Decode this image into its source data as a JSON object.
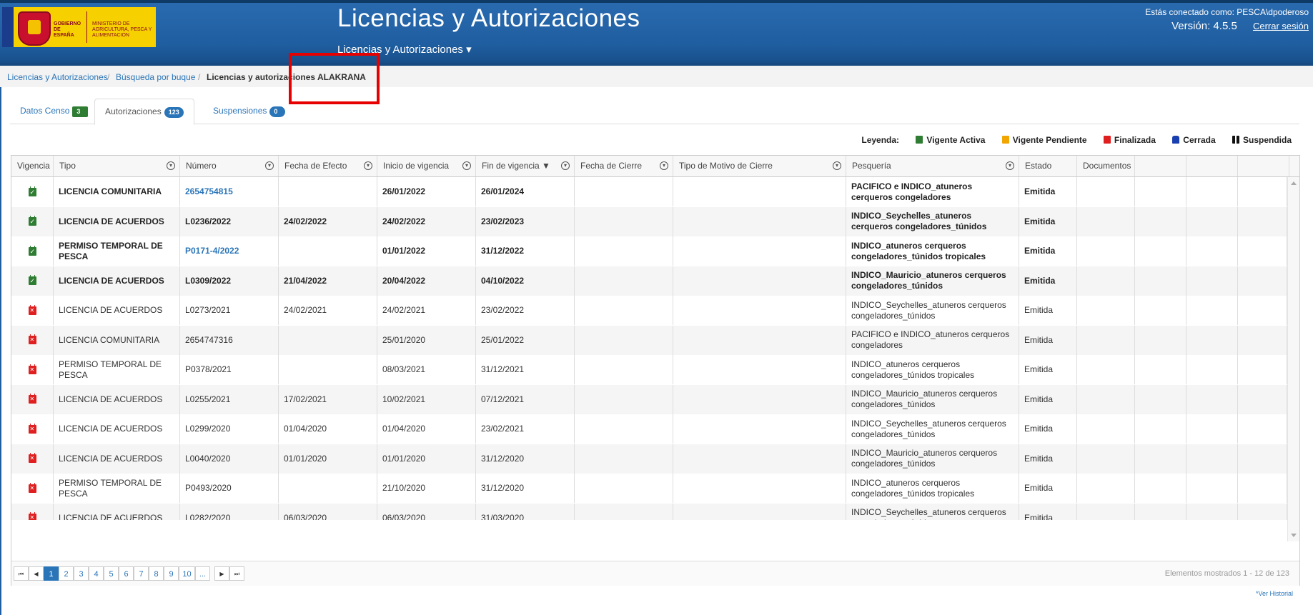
{
  "header": {
    "gov_line1": "GOBIERNO DE ESPAÑA",
    "gov_line2": "MINISTERIO DE AGRICULTURA, PESCA Y ALIMENTACIÓN",
    "title": "Licencias y Autorizaciones",
    "menu_label": "Licencias y Autorizaciones ▾",
    "user_text": "Estás conectado como: PESCA\\dpoderoso",
    "version_text": "Versión: 4.5.5",
    "logout_label": "Cerrar sesión"
  },
  "breadcrumb": {
    "item1": "Licencias y Autorizaciones",
    "item2": "Búsqueda por buque",
    "current": "Licencias y autorizaciones ALAKRANA",
    "sep": "/"
  },
  "tabs": [
    {
      "label": "Datos Censo",
      "count": "3"
    },
    {
      "label": "Autorizaciones",
      "count": "123"
    },
    {
      "label": "Suspensiones",
      "count": "0"
    }
  ],
  "legend": {
    "label": "Leyenda:",
    "items": [
      "Vigente Activa",
      "Vigente Pendiente",
      "Finalizada",
      "Cerrada",
      "Suspendida"
    ],
    "colors": [
      "#2e7d32",
      "#f0a500",
      "#e02020",
      "#1a3fb0",
      "#111111"
    ]
  },
  "columns": [
    "Vigencia",
    "Tipo",
    "Número",
    "Fecha de Efecto",
    "Inicio de vigencia",
    "Fin de vigencia ▼",
    "Fecha de Cierre",
    "Tipo de Motivo de Cierre",
    "Pesquería",
    "Estado",
    "Documentos"
  ],
  "rows": [
    {
      "vigencia": "activa",
      "tipo": "LICENCIA COMUNITARIA",
      "numero": "2654754815",
      "efecto": "",
      "inicio": "26/01/2022",
      "fin": "26/01/2024",
      "cierre": "",
      "motivo": "",
      "pesqueria": "PACIFICO e INDICO_atuneros cerqueros congeladores",
      "estado": "Emitida"
    },
    {
      "vigencia": "activa",
      "tipo": "LICENCIA DE ACUERDOS",
      "numero": "L0236/2022",
      "efecto": "24/02/2022",
      "inicio": "24/02/2022",
      "fin": "23/02/2023",
      "cierre": "",
      "motivo": "",
      "pesqueria": "INDICO_Seychelles_atuneros cerqueros congeladores_túnidos",
      "estado": "Emitida"
    },
    {
      "vigencia": "activa",
      "tipo": "PERMISO TEMPORAL DE PESCA",
      "numero": "P0171-4/2022",
      "efecto": "",
      "inicio": "01/01/2022",
      "fin": "31/12/2022",
      "cierre": "",
      "motivo": "",
      "pesqueria": "INDICO_atuneros cerqueros congeladores_túnidos tropicales",
      "estado": "Emitida"
    },
    {
      "vigencia": "activa",
      "tipo": "LICENCIA DE ACUERDOS",
      "numero": "L0309/2022",
      "efecto": "21/04/2022",
      "inicio": "20/04/2022",
      "fin": "04/10/2022",
      "cierre": "",
      "motivo": "",
      "pesqueria": "INDICO_Mauricio_atuneros cerqueros congeladores_túnidos",
      "estado": "Emitida"
    },
    {
      "vigencia": "finalizada",
      "tipo": "LICENCIA DE ACUERDOS",
      "numero": "L0273/2021",
      "efecto": "24/02/2021",
      "inicio": "24/02/2021",
      "fin": "23/02/2022",
      "cierre": "",
      "motivo": "",
      "pesqueria": "INDICO_Seychelles_atuneros cerqueros congeladores_túnidos",
      "estado": "Emitida"
    },
    {
      "vigencia": "finalizada",
      "tipo": "LICENCIA COMUNITARIA",
      "numero": "2654747316",
      "efecto": "",
      "inicio": "25/01/2020",
      "fin": "25/01/2022",
      "cierre": "",
      "motivo": "",
      "pesqueria": "PACIFICO e INDICO_atuneros cerqueros congeladores",
      "estado": "Emitida"
    },
    {
      "vigencia": "finalizada",
      "tipo": "PERMISO TEMPORAL DE PESCA",
      "numero": "P0378/2021",
      "efecto": "",
      "inicio": "08/03/2021",
      "fin": "31/12/2021",
      "cierre": "",
      "motivo": "",
      "pesqueria": "INDICO_atuneros cerqueros congeladores_túnidos tropicales",
      "estado": "Emitida"
    },
    {
      "vigencia": "finalizada",
      "tipo": "LICENCIA DE ACUERDOS",
      "numero": "L0255/2021",
      "efecto": "17/02/2021",
      "inicio": "10/02/2021",
      "fin": "07/12/2021",
      "cierre": "",
      "motivo": "",
      "pesqueria": "INDICO_Mauricio_atuneros cerqueros congeladores_túnidos",
      "estado": "Emitida"
    },
    {
      "vigencia": "finalizada",
      "tipo": "LICENCIA DE ACUERDOS",
      "numero": "L0299/2020",
      "efecto": "01/04/2020",
      "inicio": "01/04/2020",
      "fin": "23/02/2021",
      "cierre": "",
      "motivo": "",
      "pesqueria": "INDICO_Seychelles_atuneros cerqueros congeladores_túnidos",
      "estado": "Emitida"
    },
    {
      "vigencia": "finalizada",
      "tipo": "LICENCIA DE ACUERDOS",
      "numero": "L0040/2020",
      "efecto": "01/01/2020",
      "inicio": "01/01/2020",
      "fin": "31/12/2020",
      "cierre": "",
      "motivo": "",
      "pesqueria": "INDICO_Mauricio_atuneros cerqueros congeladores_túnidos",
      "estado": "Emitida"
    },
    {
      "vigencia": "finalizada",
      "tipo": "PERMISO TEMPORAL DE PESCA",
      "numero": "P0493/2020",
      "efecto": "",
      "inicio": "21/10/2020",
      "fin": "31/12/2020",
      "cierre": "",
      "motivo": "",
      "pesqueria": "INDICO_atuneros cerqueros congeladores_túnidos tropicales",
      "estado": "Emitida"
    },
    {
      "vigencia": "finalizada",
      "tipo": "LICENCIA DE ACUERDOS",
      "numero": "L0282/2020",
      "efecto": "06/03/2020",
      "inicio": "06/03/2020",
      "fin": "31/03/2020",
      "cierre": "",
      "motivo": "",
      "pesqueria": "INDICO_Seychelles_atuneros cerqueros congeladores_túnidos",
      "estado": "Emitida"
    }
  ],
  "pager": {
    "first": "⏮",
    "prev": "◀",
    "pages": [
      "1",
      "2",
      "3",
      "4",
      "5",
      "6",
      "7",
      "8",
      "9",
      "10",
      "..."
    ],
    "next": "▶",
    "last": "⏭",
    "current": "1",
    "info": "Elementos mostrados 1 - 12 de 123"
  },
  "historial_label": "*Ver Historial"
}
